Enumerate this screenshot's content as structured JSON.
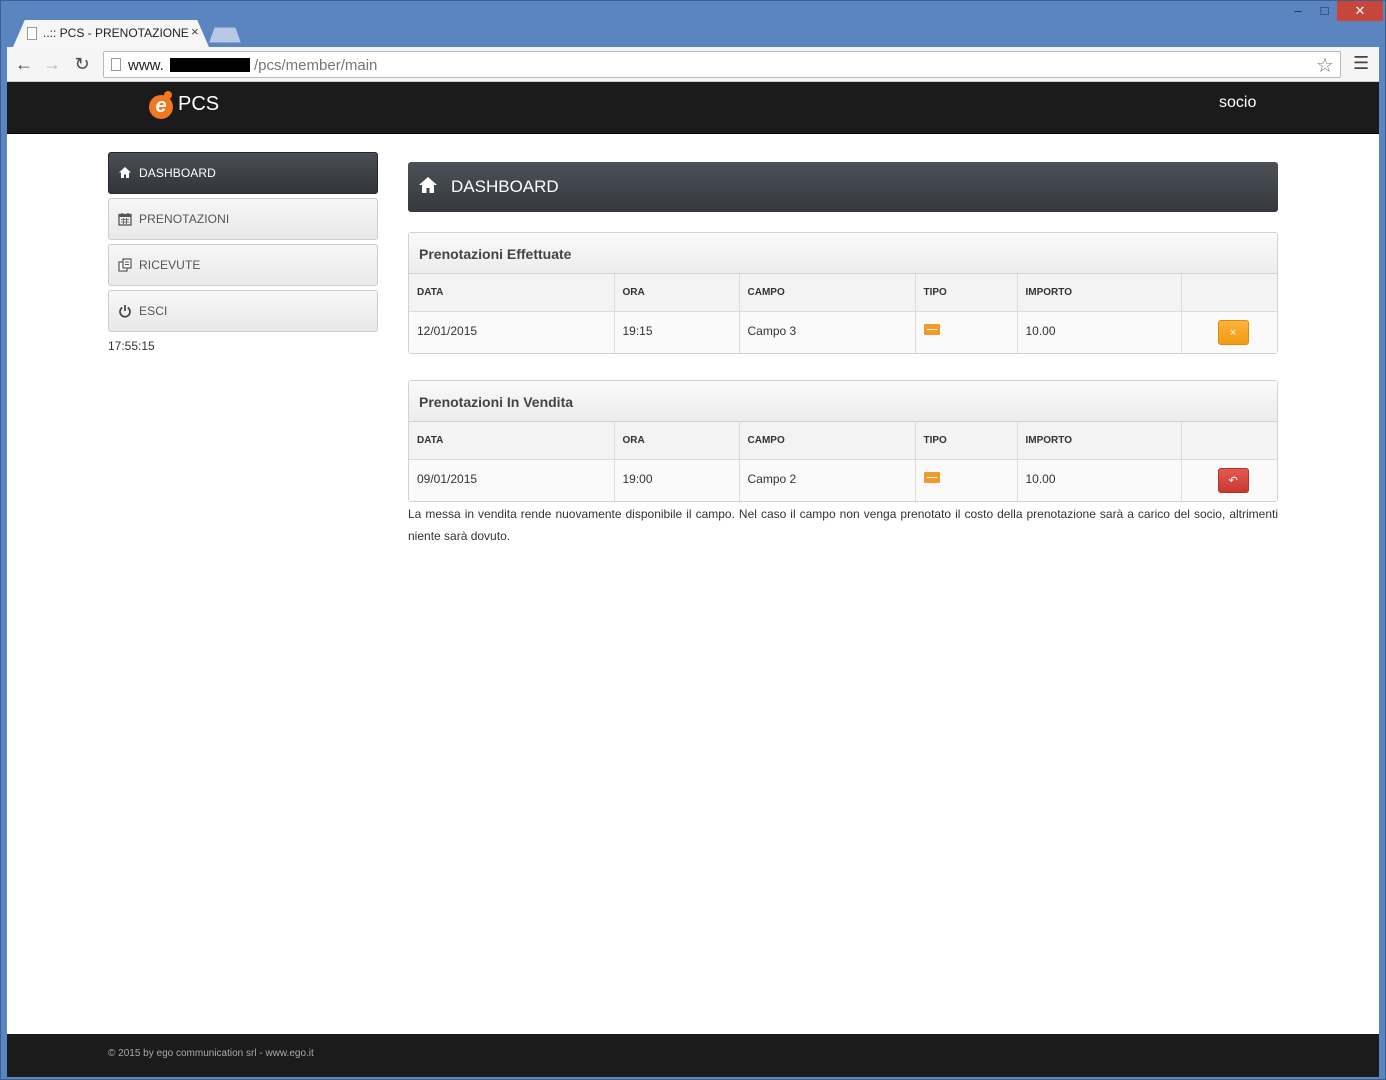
{
  "browser": {
    "tab_title": "..:: PCS - PRENOTAZIONE",
    "tab_close": "×",
    "url_host": "www.",
    "url_path": "/pcs/member/main",
    "controls": {
      "minimize": "–",
      "maximize": "□",
      "close": "✕"
    }
  },
  "topbar": {
    "brand": "PCS",
    "user": "socio"
  },
  "sidebar": {
    "items": [
      {
        "label": "DASHBOARD",
        "icon": "home-icon",
        "active": true
      },
      {
        "label": "PRENOTAZIONI",
        "icon": "calendar-icon",
        "active": false
      },
      {
        "label": "RICEVUTE",
        "icon": "receipts-icon",
        "active": false
      },
      {
        "label": "ESCI",
        "icon": "power-icon",
        "active": false
      }
    ],
    "clock": "17:55:15"
  },
  "main": {
    "title": "DASHBOARD",
    "columns": [
      "DATA",
      "ORA",
      "CAMPO",
      "TIPO",
      "IMPORTO",
      ""
    ],
    "panels": [
      {
        "title": "Prenotazioni Effettuate",
        "rows": [
          {
            "data": "12/01/2015",
            "ora": "19:15",
            "campo": "Campo 3",
            "tipo": "card-icon",
            "importo": "10.00",
            "action": "×"
          }
        ]
      },
      {
        "title": "Prenotazioni In Vendita",
        "rows": [
          {
            "data": "09/01/2015",
            "ora": "19:00",
            "campo": "Campo 2",
            "tipo": "card-icon",
            "importo": "10.00",
            "action": "↶"
          }
        ]
      }
    ],
    "note": "La messa in vendita rende nuovamente disponibile il campo. Nel caso il campo non venga prenotato il costo della prenotazione sarà a carico del socio, altrimenti niente sarà dovuto."
  },
  "footer": {
    "text": "© 2015 by ego communication srl - www.ego.it"
  },
  "colors": {
    "accent": "#f07820",
    "cancel": "#f39a12",
    "sell": "#c83a31",
    "topbar": "#1b1b1b"
  }
}
